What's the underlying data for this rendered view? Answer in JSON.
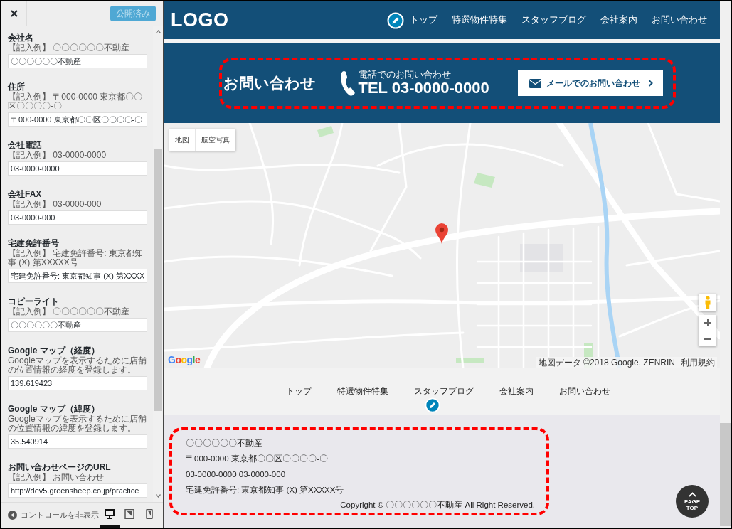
{
  "customizer": {
    "publish_button": {
      "label": "公開済み",
      "disabled": true
    },
    "fields": [
      {
        "label": "会社名",
        "description": "【記入例】 〇〇〇〇〇〇不動産",
        "value": "〇〇〇〇〇〇不動産"
      },
      {
        "label": "住所",
        "description": "【記入例】 〒000-0000 東京都〇〇区〇〇〇〇-〇",
        "value": "〒000-0000 東京都〇〇区〇〇〇〇-〇"
      },
      {
        "label": "会社電話",
        "description": "【記入例】 03-0000-0000",
        "value": "03-0000-0000"
      },
      {
        "label": "会社FAX",
        "description": "【記入例】 03-0000-000",
        "value": "03-0000-000"
      },
      {
        "label": "宅建免許番号",
        "description": "【記入例】 宅建免許番号: 東京都知事 (X) 第XXXXX号",
        "value": "宅建免許番号: 東京都知事 (X) 第XXXX"
      },
      {
        "label": "コピーライト",
        "description": "【記入例】 〇〇〇〇〇〇不動産",
        "value": "〇〇〇〇〇〇不動産"
      },
      {
        "label": "Google マップ（経度）",
        "description": "Googleマップを表示するために店舗の位置情報の経度を登録します。",
        "value": "139.619423"
      },
      {
        "label": "Google マップ（緯度）",
        "description": "Googleマップを表示するために店舗の位置情報の緯度を登録します。",
        "value": "35.540914"
      },
      {
        "label": "お問い合わせページのURL",
        "description": "【記入例】 お問い合わせ",
        "value": "http://dev5.greensheep.co.jp/practice"
      }
    ],
    "hide_controls": "コントロールを非表示",
    "devices": [
      {
        "kind": "desktop",
        "selected": true
      },
      {
        "kind": "tablet",
        "selected": false
      },
      {
        "kind": "mobile",
        "selected": false
      }
    ]
  },
  "preview": {
    "header": {
      "logo": "LOGO",
      "nav": [
        "トップ",
        "特選物件特集",
        "スタッフブログ",
        "会社案内",
        "お問い合わせ"
      ]
    },
    "contact": {
      "title": "お問い合わせ",
      "phone_caption": "電話でのお問い合わせ",
      "phone": "TEL 03-0000-0000",
      "mail_button": "メールでのお問い合わせ"
    },
    "map": {
      "map_types": [
        "地図",
        "航空写真"
      ],
      "logo": "Google",
      "attribution": "地図データ ©2018 Google, ZENRIN",
      "terms": "利用規約"
    },
    "footer_nav": [
      "トップ",
      "特選物件特集",
      "スタッフブログ",
      "会社案内",
      "お問い合わせ"
    ],
    "footer": {
      "lines": [
        "〇〇〇〇〇〇不動産",
        "〒000-0000 東京都〇〇区〇〇〇〇-〇",
        "03-0000-0000 03-0000-000",
        "宅建免許番号: 東京都知事 (X) 第XXXXX号"
      ],
      "copyright": "Copyright © 〇〇〇〇〇〇不動産 All Right Reserved.",
      "page_top": "PAGE TOP"
    }
  }
}
